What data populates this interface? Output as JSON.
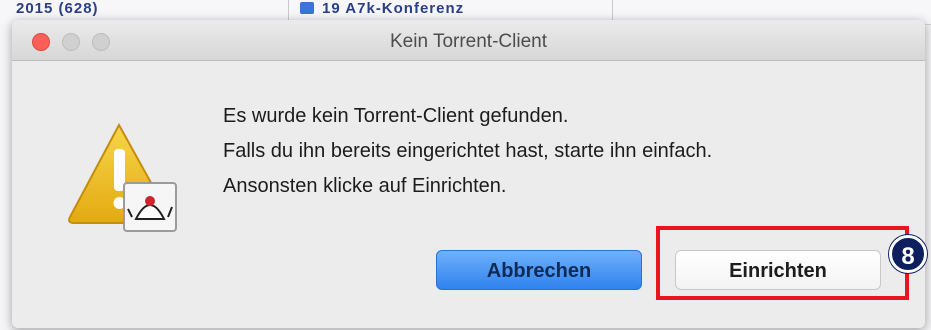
{
  "background": {
    "left_fragment": "2015 (628)",
    "mid_fragment": "19 A7k-Konferenz"
  },
  "dialog": {
    "title": "Kein Torrent-Client",
    "message_lines": [
      "Es wurde kein Torrent-Client gefunden.",
      "Falls du ihn bereits eingerichtet hast, starte ihn einfach.",
      "Ansonsten klicke auf Einrichten."
    ],
    "icon": "warning-java-icon",
    "buttons": {
      "cancel_label": "Abbrechen",
      "setup_label": "Einrichten"
    }
  },
  "annotation": {
    "step_number": "8",
    "color": "#e8161c",
    "badge_color": "#0d1f5c"
  }
}
